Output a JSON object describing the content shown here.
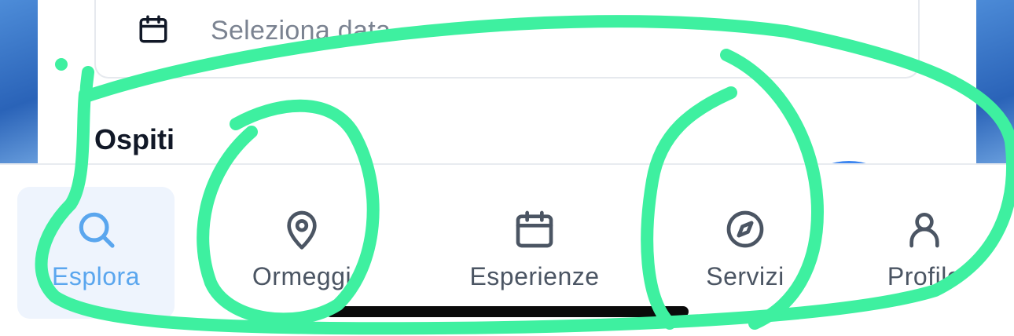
{
  "search": {
    "date_placeholder": "Seleziona data",
    "guests_label": "Ospiti"
  },
  "tabs": [
    {
      "label": "Esplora",
      "icon": "search-icon",
      "active": true
    },
    {
      "label": "Ormeggi",
      "icon": "map-pin-icon",
      "active": false
    },
    {
      "label": "Esperienze",
      "icon": "calendar-icon",
      "active": false
    },
    {
      "label": "Servizi",
      "icon": "compass-icon",
      "active": false
    },
    {
      "label": "Profilo",
      "icon": "user-icon",
      "active": false
    }
  ],
  "colors": {
    "accent": "#5aa6ee",
    "annotation": "#3ef0a0",
    "background": "#2f6fc4"
  }
}
